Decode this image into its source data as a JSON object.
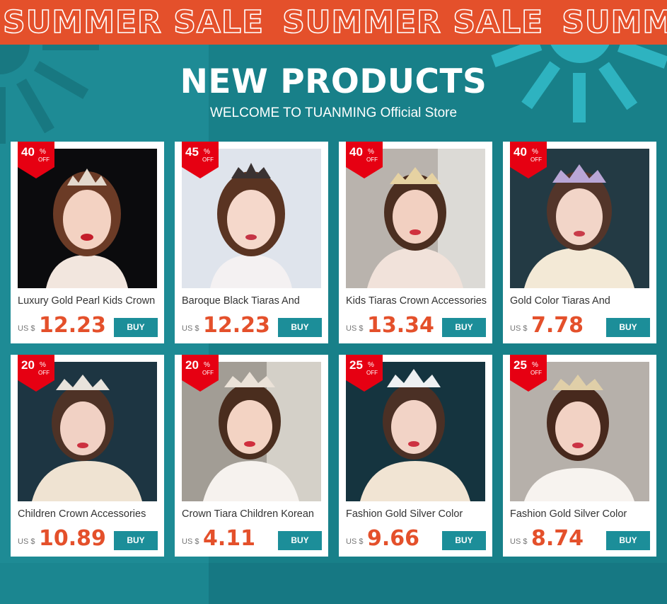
{
  "banner": {
    "text": "SUMMER SALE",
    "repeat_text": "SUMME"
  },
  "header": {
    "title": "NEW PRODUCTS",
    "subtitle": "WELCOME TO TUANMING Official Store"
  },
  "colors": {
    "banner_bg": "#e4502b",
    "page_bg": "#1f8c96",
    "price": "#e4502b",
    "buy_button": "#1c8e99",
    "badge": "#e60012"
  },
  "products": [
    {
      "name": "Luxury Gold Pearl Kids Crown",
      "discount": "40",
      "pct": "%",
      "off": "OFF",
      "currency": "US $",
      "price": "12.23",
      "buy_label": "BUY",
      "photo_icon": "girl-tiara-photo-icon"
    },
    {
      "name": "Baroque Black Tiaras And",
      "discount": "45",
      "pct": "%",
      "off": "OFF",
      "currency": "US $",
      "price": "12.23",
      "buy_label": "BUY",
      "photo_icon": "girl-tiara-photo-icon"
    },
    {
      "name": "Kids Tiaras Crown Accessories",
      "discount": "40",
      "pct": "%",
      "off": "OFF",
      "currency": "US $",
      "price": "13.34",
      "buy_label": "BUY",
      "photo_icon": "girl-tiara-photo-icon"
    },
    {
      "name": "Gold Color Tiaras And",
      "discount": "40",
      "pct": "%",
      "off": "OFF",
      "currency": "US $",
      "price": "7.78",
      "buy_label": "BUY",
      "photo_icon": "girl-tiara-photo-icon"
    },
    {
      "name": "Children Crown Accessories",
      "discount": "20",
      "pct": "%",
      "off": "OFF",
      "currency": "US $",
      "price": "10.89",
      "buy_label": "BUY",
      "photo_icon": "girl-tiara-photo-icon"
    },
    {
      "name": "Crown Tiara Children Korean",
      "discount": "20",
      "pct": "%",
      "off": "OFF",
      "currency": "US $",
      "price": "4.11",
      "buy_label": "BUY",
      "photo_icon": "girl-tiara-photo-icon"
    },
    {
      "name": "Fashion Gold Silver Color",
      "discount": "25",
      "pct": "%",
      "off": "OFF",
      "currency": "US $",
      "price": "9.66",
      "buy_label": "BUY",
      "photo_icon": "girl-tiara-photo-icon"
    },
    {
      "name": "Fashion Gold Silver Color",
      "discount": "25",
      "pct": "%",
      "off": "OFF",
      "currency": "US $",
      "price": "8.74",
      "buy_label": "BUY",
      "photo_icon": "girl-tiara-photo-icon"
    }
  ]
}
